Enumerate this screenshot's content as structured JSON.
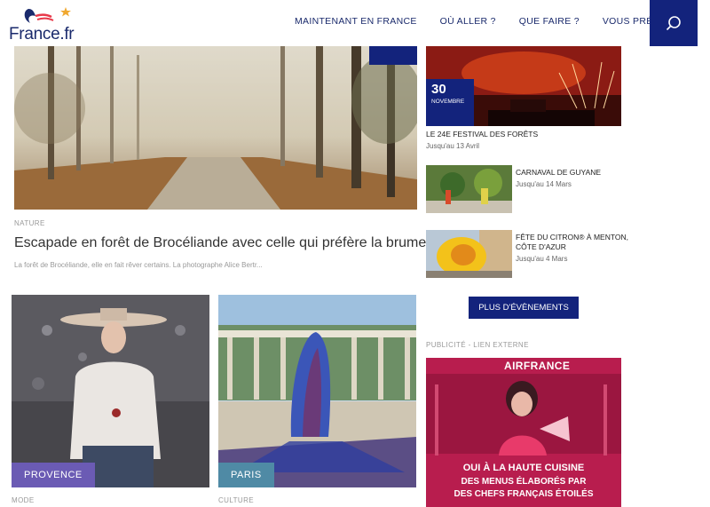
{
  "header": {
    "logo": "France.fr",
    "nav": [
      "MAINTENANT EN FRANCE",
      "OÙ ALLER ?",
      "QUE FAIRE ?",
      "VOUS PRÉPARER"
    ]
  },
  "hero": {
    "category": "NATURE",
    "title": "Escapade en forêt de Brocéliande avec celle qui préfère la brume",
    "excerpt": "La forêt de Brocéliande, elle en fait rêver certains. La photographe Alice Bertr..."
  },
  "cards": [
    {
      "badge": "PROVENCE",
      "category": "MODE",
      "badge_color": "#6b5bb4"
    },
    {
      "badge": "PARIS",
      "category": "CULTURE",
      "badge_color": "#4f8aa5"
    }
  ],
  "events": [
    {
      "day": "30",
      "month": "NOVEMBRE",
      "title": "LE 24E FESTIVAL DES FORÊTS",
      "date": "Jusqu'au 13 Avril"
    },
    {
      "title": "CARNAVAL DE GUYANE",
      "date": "Jusqu'au 14 Mars"
    },
    {
      "title_line1": "FÊTE DU CITRON® À MENTON,",
      "title_line2": "CÔTE D'AZUR",
      "date": "Jusqu'au 4 Mars"
    }
  ],
  "more_events_label": "PLUS D'ÉVÈNEMENTS",
  "ad": {
    "label": "PUBLICITÉ - LIEN EXTERNE",
    "brand": "AIRFRANCE",
    "line1": "OUI À LA HAUTE CUISINE",
    "line2": "DES MENUS ÉLABORÉS PAR",
    "line3": "DES CHEFS FRANÇAIS ÉTOILÉS"
  },
  "colors": {
    "primary": "#13237c"
  }
}
